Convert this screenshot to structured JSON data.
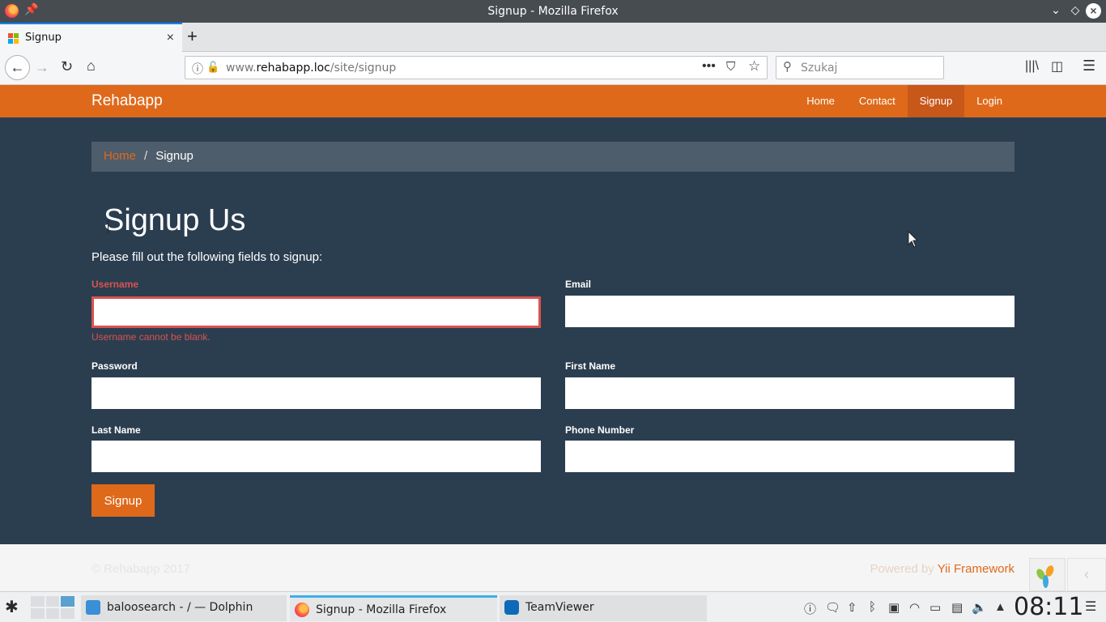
{
  "window": {
    "title": "Signup - Mozilla Firefox"
  },
  "tab": {
    "label": "Signup",
    "close": "×",
    "new_tab": "+"
  },
  "navbar": {
    "url_host": "www.rehabapp.loc",
    "url_domain": "rehabapp.loc",
    "url_prefix": "www.",
    "url_path": "/site/signup",
    "search_placeholder": "Szukaj"
  },
  "site": {
    "brand": "Rehabapp",
    "nav": [
      {
        "label": "Home",
        "active": false
      },
      {
        "label": "Contact",
        "active": false
      },
      {
        "label": "Signup",
        "active": true
      },
      {
        "label": "Login",
        "active": false
      }
    ],
    "breadcrumb": {
      "home": "Home",
      "separator": "/",
      "current": "Signup"
    },
    "heading": "Signup Us",
    "lead": "Please fill out the following fields to signup:",
    "form": {
      "username_label": "Username",
      "username_error": "Username cannot be blank.",
      "email_label": "Email",
      "password_label": "Password",
      "first_name_label": "First Name",
      "last_name_label": "Last Name",
      "phone_label": "Phone Number",
      "submit_label": "Signup"
    },
    "footer": {
      "copyright": "© Rehabapp 2017",
      "powered_prefix": "Powered by ",
      "powered_link": "Yii Framework"
    }
  },
  "taskbar": {
    "tasks": [
      {
        "label": "baloosearch - / — Dolphin"
      },
      {
        "label": "Signup - Mozilla Firefox"
      },
      {
        "label": "TeamViewer"
      }
    ],
    "clock": "08:11"
  },
  "colors": {
    "accent": "#df691a",
    "page_bg": "#2b3e50",
    "error": "#d9534f",
    "breadcrumb_bg": "#4e5d6c"
  }
}
